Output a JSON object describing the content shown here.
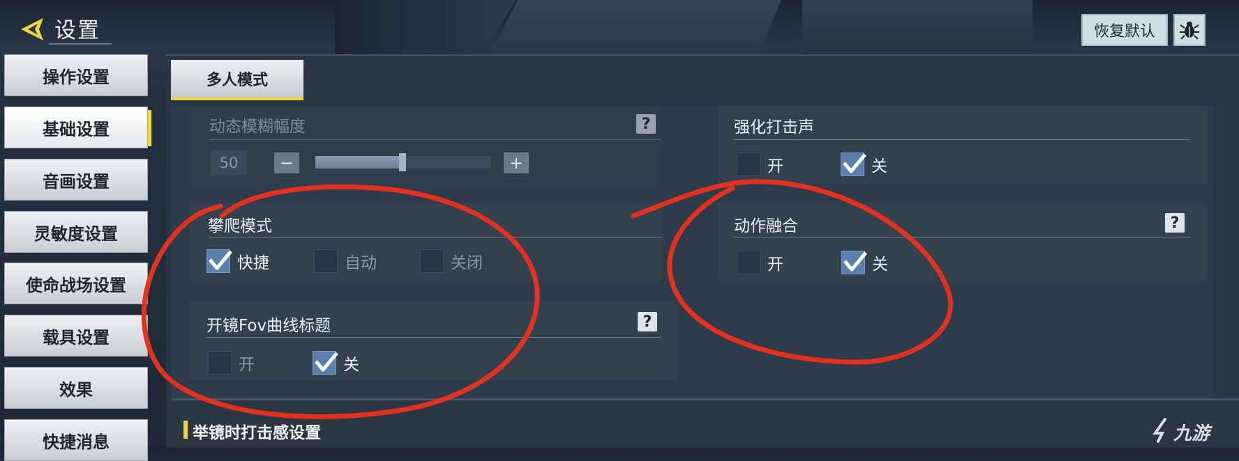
{
  "header": {
    "title": "设置",
    "reset_label": "恢复默认",
    "bug_icon": "bug-icon"
  },
  "sidebar": {
    "items": [
      {
        "label": "操作设置",
        "active": false
      },
      {
        "label": "基础设置",
        "active": true
      },
      {
        "label": "音画设置",
        "active": false
      },
      {
        "label": "灵敏度设置",
        "active": false
      },
      {
        "label": "使命战场设置",
        "active": false
      },
      {
        "label": "载具设置",
        "active": false
      },
      {
        "label": "效果",
        "active": false
      },
      {
        "label": "快捷消息",
        "active": false
      }
    ]
  },
  "tabs": {
    "mode_label": "多人模式"
  },
  "settings": {
    "motion_blur": {
      "label": "动态模糊幅度",
      "value": "50",
      "minus": "−",
      "plus": "+",
      "slider_level": 0.5,
      "enabled": false
    },
    "hit_sound": {
      "label": "强化打击声",
      "on_label": "开",
      "off_label": "关",
      "selected": "off"
    },
    "climb_mode": {
      "label": "攀爬模式",
      "options": [
        "快捷",
        "自动",
        "关闭"
      ],
      "selected": "快捷"
    },
    "action_blend": {
      "label": "动作融合",
      "on_label": "开",
      "off_label": "关",
      "selected": "off"
    },
    "scope_fov": {
      "label": "开镜Fov曲线标题",
      "on_label": "开",
      "off_label": "关",
      "selected": "off"
    },
    "help_glyph": "?"
  },
  "section": {
    "title": "举镜时打击感设置"
  },
  "watermark": {
    "text": "九游"
  },
  "colors": {
    "accent_yellow": "#f1d83a",
    "check_blue": "#5d7fad",
    "annotation_red": "#e0321f"
  }
}
